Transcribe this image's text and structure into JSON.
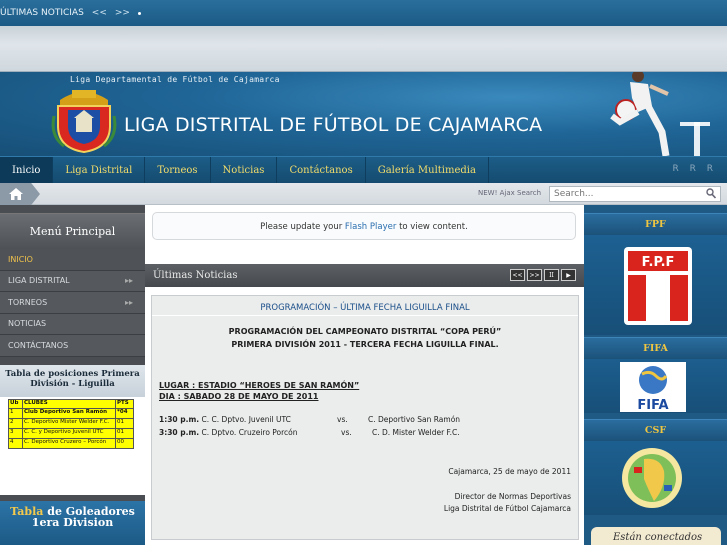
{
  "ticker": {
    "label": "ÚLTIMAS NOTICIAS",
    "prev": "<<",
    "next": ">>"
  },
  "header": {
    "tagline": "Liga Departamental de Fútbol de Cajamarca",
    "title": "LIGA DISTRITAL DE FÚTBOL DE CAJAMARCA"
  },
  "nav": {
    "items": [
      "Inicio",
      "Liga Distrital",
      "Torneos",
      "Noticias",
      "Contáctanos",
      "Galería Multimedia"
    ],
    "font_sizes": "R R R"
  },
  "search": {
    "label": "NEW! Ajax Search",
    "placeholder": "Search..."
  },
  "left": {
    "menu_title": "Menú Principal",
    "menu": [
      "INICIO",
      "LIGA DISTRITAL",
      "TORNEOS",
      "NOTICIAS",
      "CONTÁCTANOS"
    ],
    "standings": {
      "title": "Tabla de posiciones Primera División - Liguilla",
      "headers": [
        "Ub",
        "CLUBES",
        "PTS"
      ],
      "rows": [
        [
          "1",
          "Club Deportivo San Ramón",
          "*04"
        ],
        [
          "2",
          "C. Deportivo Mister Welder F.C.",
          "01"
        ],
        [
          "3",
          "C. C. y Deportivo Juvenil UTC",
          "01"
        ],
        [
          "4",
          "C. Deportivo Cruzero – Porcón",
          "00"
        ]
      ]
    },
    "scorers": {
      "title_highlight": "Tabla",
      "title_rest": "de Goleadores",
      "subtitle": "1era Division"
    }
  },
  "center": {
    "flash_text_pre": "Please update your",
    "flash_link": "Flash Player",
    "flash_text_post": "to view content.",
    "news_title": "Últimas Noticias",
    "news_controls": [
      "<<",
      ">>",
      "II",
      "▶"
    ],
    "article": {
      "title": "PROGRAMACIÓN – ÚLTIMA FECHA LIGUILLA FINAL",
      "heading": "PROGRAMACIÓN DEL CAMPEONATO DISTRITAL “COPA PERÚ” PRIMERA DIVISIÓN 2011 - TERCERA FECHA LIGUILLA FINAL.",
      "lugar": "LUGAR : ESTADIO “HEROES DE SAN RAMÓN”",
      "dia": "DIA : SABADO 28 DE MAYO DE 2011",
      "matches": [
        {
          "time": "1:30 p.m.",
          "team1": "C. C. Dptvo. Juvenil UTC",
          "vs": "vs.",
          "team2": "C. Deportivo San Ramón"
        },
        {
          "time": "3:30 p.m.",
          "team1": "C. Dptvo.  Cruzeiro Porcón",
          "vs": "vs.",
          "team2": "C. D. Mister Welder F.C."
        }
      ],
      "date_line": "Cajamarca, 25 de mayo de 2011",
      "signature_1": "Director de Normas Deportivas",
      "signature_2": "Liga Distrital de Fútbol Cajamarca"
    }
  },
  "right": {
    "fpf_title": "FPF",
    "fpf_logo_text": "F.P.F",
    "fifa_title": "FIFA",
    "fifa_logo_text": "FIFA",
    "csf_title": "CSF",
    "connected": "Están conectados"
  },
  "colors": {
    "brand_blue": "#1f6596",
    "nav_gold": "#f2dc6a",
    "accent_gold": "#f0c640",
    "standings_yellow": "#ffff00"
  }
}
